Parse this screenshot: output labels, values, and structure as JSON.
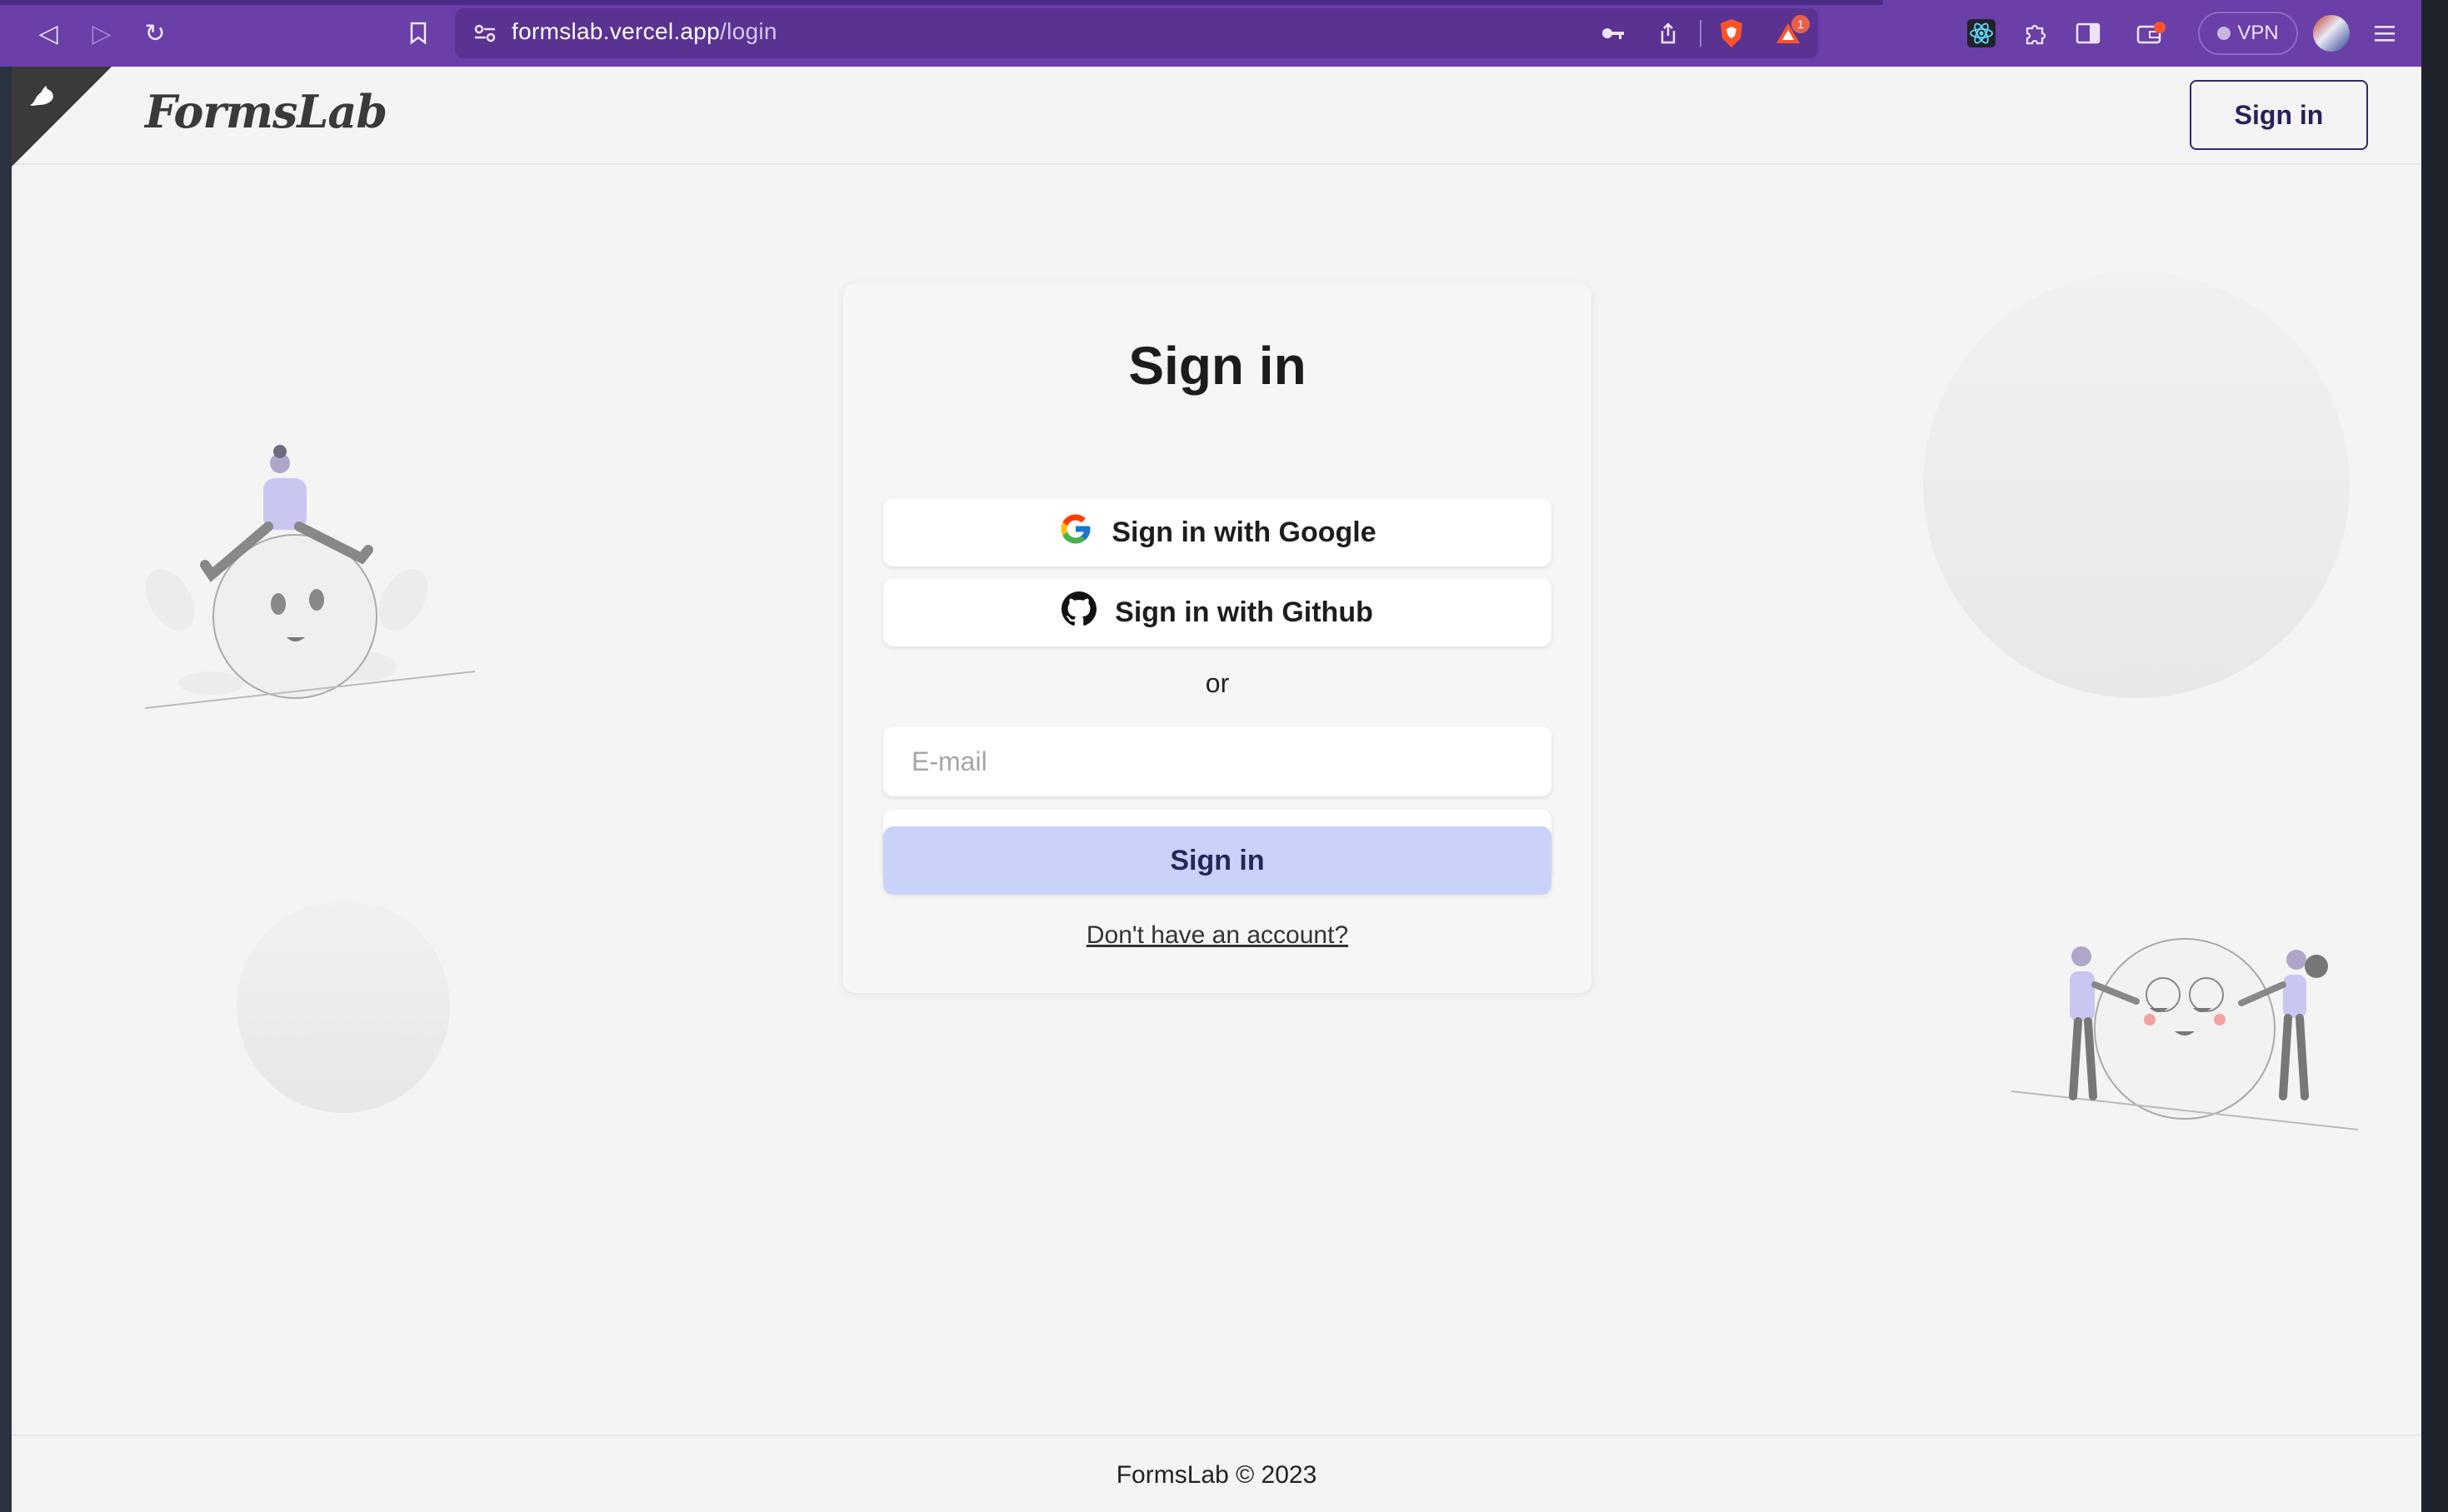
{
  "browser": {
    "url_host": "formslab.vercel.app",
    "url_path": "/login",
    "vpn_label": "VPN",
    "notification_count": "1",
    "icons": [
      "back-icon",
      "forward-icon",
      "reload-icon",
      "bookmark-icon",
      "site-settings-icon",
      "key-icon",
      "share-icon",
      "brave-shield-icon",
      "brave-rewards-icon",
      "react-devtools-icon",
      "extensions-icon",
      "sidebar-icon",
      "wallet-icon",
      "menu-icon"
    ]
  },
  "header": {
    "logo": "FormsLab",
    "signin_label": "Sign in"
  },
  "card": {
    "title": "Sign in",
    "google_label": "Sign in with Google",
    "github_label": "Sign in with Github",
    "or_label": "or",
    "email_placeholder": "E-mail",
    "password_value": "",
    "submit_label": "Sign in",
    "signup_link": "Don't have an account?"
  },
  "footer": {
    "text": "FormsLab © 2023"
  },
  "colors": {
    "chrome": "#6a3fa8",
    "page_bg": "#f4f4f4",
    "submit_bg": "#cbd2fa",
    "brand_dark": "#25225c"
  }
}
